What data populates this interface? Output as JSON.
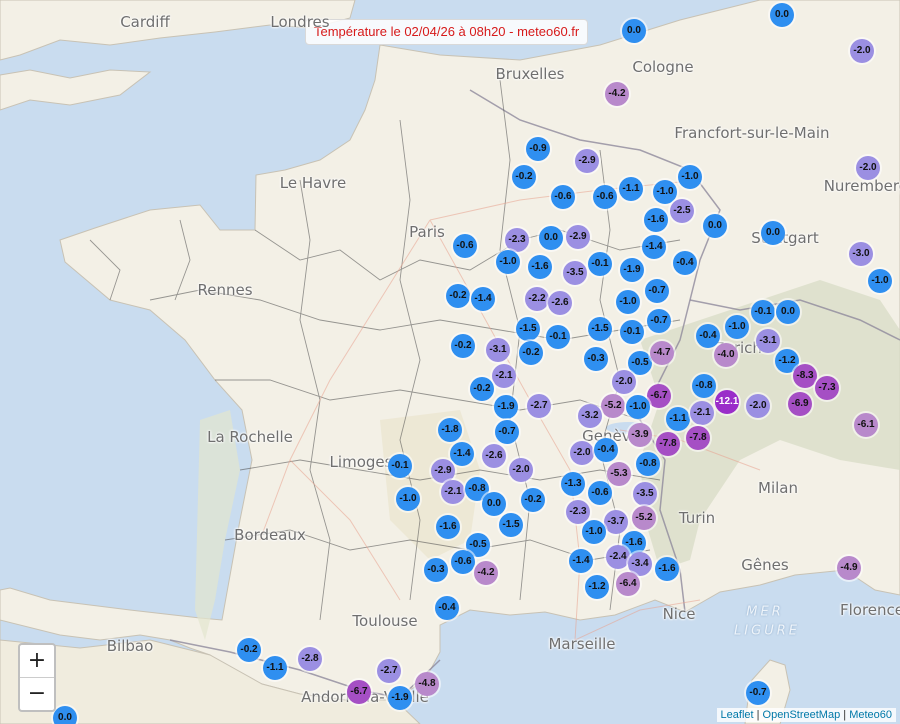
{
  "title": "Température le 02/04/26 à 08h20 - meteo60.fr",
  "zoom": {
    "in_label": "+",
    "out_label": "−"
  },
  "attribution": {
    "leaflet": "Leaflet",
    "osm": "OpenStreetMap",
    "meteo60": "Meteo60",
    "separator": " | "
  },
  "colors": {
    "cold_blue": "#2f8ff0",
    "lavender": "#9b8fe2",
    "mauve": "#b889cb",
    "violet": "#a54fc4",
    "deep_purple": "#9a2dc9",
    "title_red": "#d71a1a",
    "sea": "#c9dcef",
    "land": "#f3f0e6"
  },
  "cities": [
    "Cardiff",
    "Londres",
    "Bruxelles",
    "Cologne",
    "Francfort-sur-le-Main",
    "Nuremberg",
    "Le Havre",
    "Paris",
    "Stuttgart",
    "Rennes",
    "Zurich",
    "La Rochelle",
    "Limoges",
    "Genève",
    "Milan",
    "Bordeaux",
    "Turin",
    "Gênes",
    "Toulouse",
    "Nice",
    "Marseille",
    "Bilbao",
    "Andorre-la-Vieille",
    "Florence"
  ],
  "sea_label": [
    "MER",
    "LIGURE"
  ],
  "temperatures": [
    "0.0",
    "0.0",
    "-2.0",
    "-4.2",
    "-0.9",
    "-2.9",
    "-0.2",
    "-1.1",
    "-1.0",
    "-1.0",
    "-2.0",
    "-0.6",
    "-0.6",
    "-1.6",
    "-2.5",
    "0.0",
    "0.0",
    "-0.6",
    "-2.3",
    "0.0",
    "-2.9",
    "-1.4",
    "-3.0",
    "-1.0",
    "-1.6",
    "-3.5",
    "-0.1",
    "-1.9",
    "-0.4",
    "-1.0",
    "-0.2",
    "-1.4",
    "-2.2",
    "-2.6",
    "-1.0",
    "-0.7",
    "-0.1",
    "0.0",
    "-1.5",
    "-0.1",
    "-1.5",
    "-0.1",
    "-0.7",
    "-0.4",
    "-1.0",
    "-0.2",
    "-3.1",
    "-0.2",
    "-0.3",
    "-0.5",
    "-4.7",
    "-4.0",
    "-3.1",
    "-2.1",
    "-1.2",
    "-8.3",
    "-0.2",
    "-2.0",
    "-0.8",
    "-7.3",
    "-6.7",
    "-12.1",
    "-1.9",
    "-2.7",
    "-5.2",
    "-1.0",
    "-2.0",
    "-6.9",
    "-1.8",
    "-3.2",
    "-1.1",
    "-2.1",
    "-0.7",
    "-3.9",
    "-7.8",
    "-7.8",
    "-6.1",
    "-1.4",
    "-2.6",
    "-2.0",
    "-0.4",
    "-0.1",
    "-2.9",
    "-2.0",
    "-0.8",
    "-5.3",
    "-2.1",
    "-0.8",
    "-1.3",
    "-0.6",
    "-3.5",
    "-1.0",
    "0.0",
    "-0.2",
    "-1.6",
    "-1.5",
    "-2.3",
    "-3.7",
    "-5.2",
    "-1.0",
    "-0.5",
    "-1.6",
    "-0.6",
    "-1.4",
    "-2.4",
    "-0.3",
    "-4.2",
    "-3.4",
    "-1.6",
    "-4.9",
    "-1.2",
    "-6.4",
    "-0.4",
    "-0.2",
    "-1.1",
    "-2.8",
    "-2.7",
    "-4.8",
    "-6.7",
    "-1.9",
    "-0.7",
    "0.0"
  ]
}
